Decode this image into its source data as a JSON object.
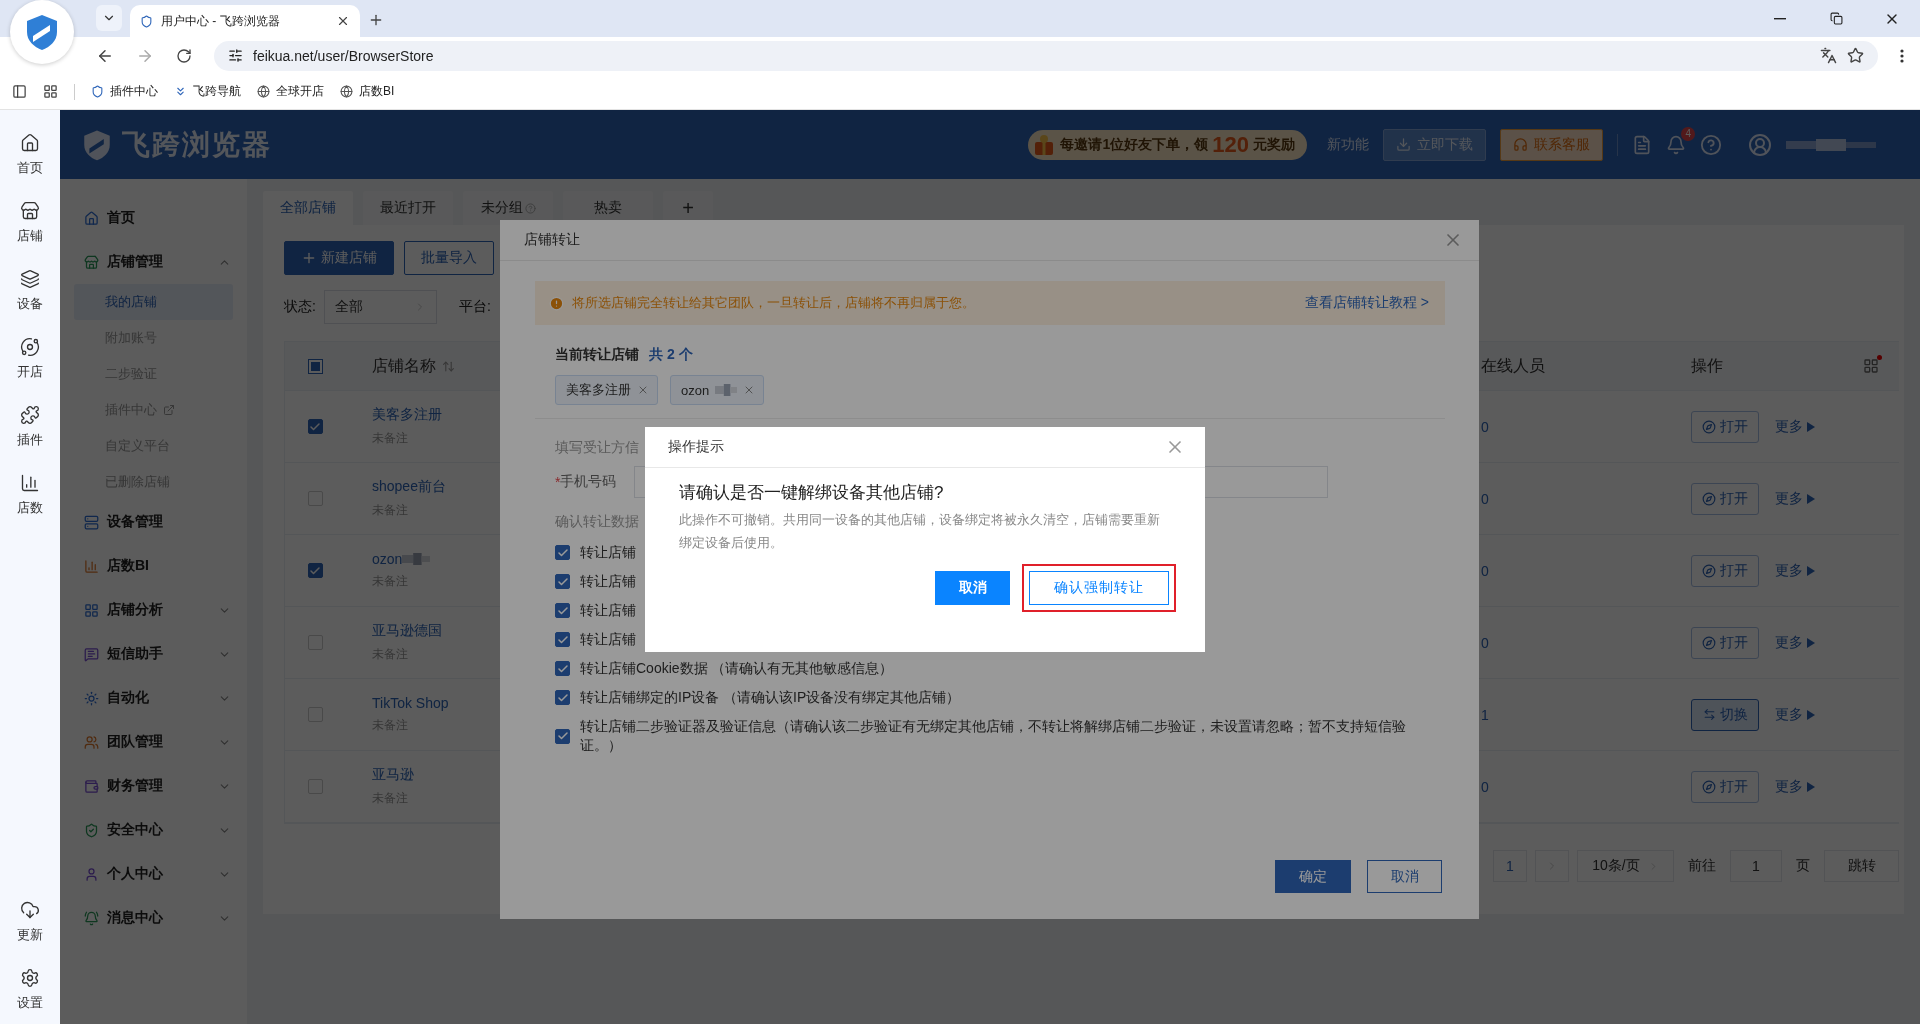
{
  "browser": {
    "tab_title": "用户中心 - 飞跨浏览器",
    "url": "feikua.net/user/BrowserStore",
    "bookmarks": [
      "插件中心",
      "飞跨导航",
      "全球开店",
      "店数BI"
    ]
  },
  "rail": {
    "top": [
      "首页",
      "店铺",
      "设备",
      "开店",
      "插件",
      "店数"
    ],
    "bottom": [
      "更新",
      "设置"
    ]
  },
  "header": {
    "logo": "飞跨浏览器",
    "promo_before": "每邀请1位好友下单，领",
    "promo_amount": "120",
    "promo_after": "元奖励",
    "new_features": "新功能",
    "download": "立即下载",
    "support": "联系客服",
    "notifications": "4"
  },
  "sidebar": {
    "items": [
      {
        "label": "首页"
      },
      {
        "label": "店铺管理",
        "expanded": true,
        "children": [
          {
            "label": "我的店铺",
            "selected": true
          },
          {
            "label": "附加账号",
            "selected": false
          },
          {
            "label": "二步验证",
            "selected": false
          },
          {
            "label": "插件中心",
            "selected": false,
            "external": true
          },
          {
            "label": "自定义平台",
            "selected": false
          },
          {
            "label": "已删除店铺",
            "selected": false
          }
        ]
      },
      {
        "label": "设备管理"
      },
      {
        "label": "店数BI"
      },
      {
        "label": "店铺分析",
        "expanded": false
      },
      {
        "label": "短信助手",
        "expanded": false
      },
      {
        "label": "自动化",
        "expanded": false
      },
      {
        "label": "团队管理",
        "expanded": false
      },
      {
        "label": "财务管理",
        "expanded": false
      },
      {
        "label": "安全中心",
        "expanded": false
      },
      {
        "label": "个人中心",
        "expanded": false
      },
      {
        "label": "消息中心",
        "expanded": false
      }
    ]
  },
  "tabs": [
    {
      "label": "全部店铺",
      "selected": true
    },
    {
      "label": "最近打开",
      "selected": false
    },
    {
      "label": "未分组",
      "selected": false
    },
    {
      "label": "热卖",
      "selected": false
    }
  ],
  "add_tab": "+",
  "toolbar": {
    "new_store": "新建店铺",
    "import": "批量导入"
  },
  "filters": {
    "status_label": "状态:",
    "status_value": "全部",
    "platform_label": "平台:"
  },
  "table": {
    "select_all": {
      "indeterminate": true
    },
    "columns": [
      "店铺名称",
      "在线人员",
      "操作"
    ],
    "rows": [
      {
        "name": "美客多注册",
        "redacted": false,
        "note": "未备注",
        "checked": true,
        "online": "0",
        "action": {
          "kind": "open",
          "label": "打开"
        },
        "more": "更多"
      },
      {
        "name": "shopee前台",
        "redacted": false,
        "note": "未备注",
        "checked": false,
        "online": "0",
        "action": {
          "kind": "open",
          "label": "打开"
        },
        "more": "更多"
      },
      {
        "name": "ozon",
        "redacted": true,
        "note": "未备注",
        "checked": true,
        "online": "0",
        "action": {
          "kind": "open",
          "label": "打开"
        },
        "more": "更多"
      },
      {
        "name": "亚马逊德国",
        "redacted": false,
        "note": "未备注",
        "checked": false,
        "online": "0",
        "action": {
          "kind": "open",
          "label": "打开"
        },
        "more": "更多"
      },
      {
        "name": "TikTok Shop",
        "redacted": false,
        "note": "未备注",
        "checked": false,
        "online": "1",
        "action": {
          "kind": "switch",
          "label": "切换"
        },
        "more": "更多"
      },
      {
        "name": "亚马逊",
        "redacted": false,
        "note": "未备注",
        "checked": false,
        "online": "0",
        "action": {
          "kind": "open",
          "label": "打开"
        },
        "more": "更多"
      }
    ]
  },
  "pagination": {
    "page": "1",
    "page_size": "10条/页",
    "goto_label": "前往",
    "goto_value": "1",
    "page_unit": "页",
    "jump": "跳转"
  },
  "transfer_dialog": {
    "title": "店铺转让",
    "warning": "将所选店铺完全转让给其它团队，一旦转让后，店铺将不再归属于您。",
    "tutorial_link": "查看店铺转让教程 >",
    "current_label": "当前转让店铺",
    "count": "共 2 个",
    "tags": [
      {
        "label": "美客多注册",
        "redacted": false
      },
      {
        "label": "ozon",
        "redacted": true
      }
    ],
    "recipient_section": "填写受让方信",
    "required_mark": "*",
    "phone_label": "手机号码",
    "data_section": "确认转让数据",
    "options": [
      {
        "label": "转让店铺",
        "checked": true
      },
      {
        "label": "转让店铺",
        "checked": true
      },
      {
        "label": "转让店铺",
        "checked": true
      },
      {
        "label": "转让店铺",
        "checked": true
      },
      {
        "label": "转让店铺Cookie数据 （请确认有无其他敏感信息）",
        "checked": true
      },
      {
        "label": "转让店铺绑定的IP设备 （请确认该IP设备没有绑定其他店铺）",
        "checked": true
      },
      {
        "label": "转让店铺二步验证器及验证信息（请确认该二步验证有无绑定其他店铺，不转让将解绑店铺二步验证，未设置请忽略；暂不支持短信验证。）",
        "checked": true
      }
    ],
    "confirm": "确定",
    "cancel": "取消"
  },
  "confirm_dialog": {
    "title": "操作提示",
    "heading": "请确认是否一键解绑设备其他店铺?",
    "description": "此操作不可撤销。共用同一设备的其他店铺，设备绑定将被永久清空，店铺需要重新绑定设备后使用。",
    "cancel": "取消",
    "confirm": "确认强制转让",
    "highlighted": true
  }
}
